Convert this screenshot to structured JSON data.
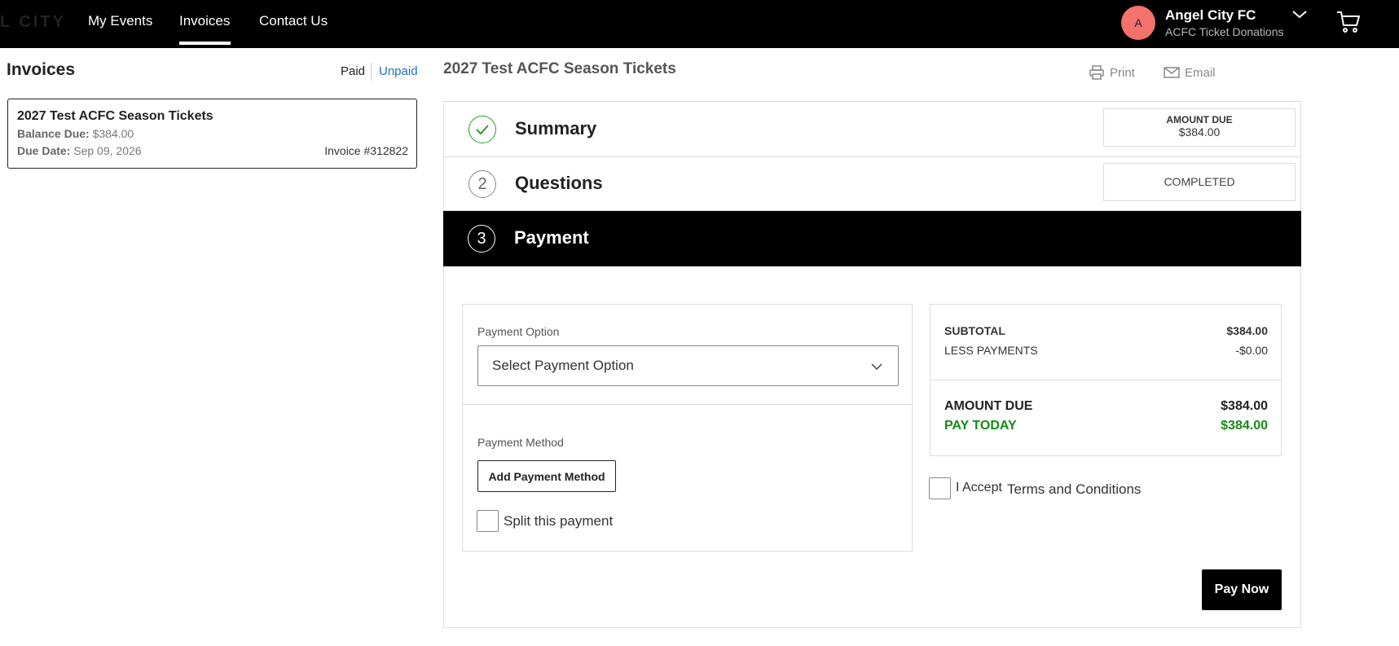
{
  "nav": {
    "logo_fragment": "L CITY",
    "links": [
      "My Events",
      "Invoices",
      "Contact Us"
    ],
    "active": "Invoices",
    "account": {
      "initial": "A",
      "name": "Angel City FC",
      "subtitle": "ACFC Ticket Donations"
    },
    "icons": [
      "chevron-down-icon",
      "cart-icon"
    ]
  },
  "sidebar": {
    "title": "Invoices",
    "filters": {
      "paid": "Paid",
      "unpaid": "Unpaid",
      "active": "unpaid"
    },
    "invoices": [
      {
        "title": "2027 Test ACFC Season Tickets",
        "balance_label": "Balance Due:",
        "balance_value": "$384.00",
        "due_label": "Due Date:",
        "due_value": "Sep 09, 2026",
        "invoice_number": "Invoice #312822"
      }
    ]
  },
  "main": {
    "title": "2027 Test ACFC Season Tickets",
    "actions": {
      "print": "Print",
      "email": "Email"
    },
    "steps": [
      {
        "label": "Summary",
        "status": "done",
        "box_title": "AMOUNT DUE",
        "box_value": "$384.00"
      },
      {
        "label": "Questions",
        "number": "2",
        "box_value": "COMPLETED"
      },
      {
        "label": "Payment",
        "number": "3",
        "active": true
      }
    ],
    "payment": {
      "option_label": "Payment Option",
      "option_value": "Select Payment Option",
      "method_label": "Payment Method",
      "add_method": "Add Payment Method",
      "split_label": "Split this payment",
      "summary": {
        "subtotal_label": "SUBTOTAL",
        "subtotal_value": "$384.00",
        "less_label": "LESS PAYMENTS",
        "less_value": "-$0.00",
        "due_label": "AMOUNT DUE",
        "due_value": "$384.00",
        "today_label": "PAY TODAY",
        "today_value": "$384.00"
      },
      "accept_label": "I Accept",
      "terms_label": "Terms and Conditions",
      "pay_now": "Pay Now"
    }
  },
  "colors": {
    "accent_link": "#1a6fc9",
    "success": "#178a17",
    "avatar": "#f4726c",
    "dark": "#000000"
  }
}
